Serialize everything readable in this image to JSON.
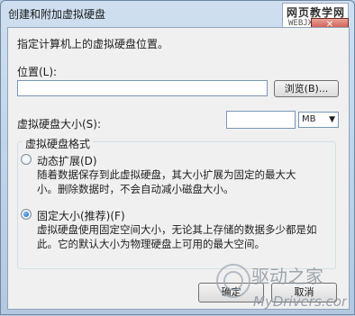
{
  "window": {
    "title": "创建和附加虚拟硬盘",
    "close_glyph": "✕"
  },
  "watermark_top": {
    "line1": "网页教学网",
    "line2": "WEBJX.COM"
  },
  "instruction": "指定计算机上的虚拟硬盘位置。",
  "location": {
    "label": "位置(L):",
    "value": "",
    "browse_label": "浏览(B)..."
  },
  "size": {
    "label": "虚拟硬盘大小(S):",
    "value": "",
    "unit": "MB"
  },
  "format": {
    "group_label": "虚拟硬盘格式",
    "dynamic": {
      "label": "动态扩展(D)",
      "selected": false,
      "desc_line1": "随着数据保存到此虚拟硬盘，其大小扩展为固定的最大大",
      "desc_line2": "小。删除数据时，不会自动减小磁盘大小。"
    },
    "fixed": {
      "label": "固定大小(推荐)(F)",
      "selected": true,
      "desc_line1": "虚拟硬盘使用固定空间大小，无论其上存储的数据多少都是如",
      "desc_line2": "此。它的默认大小为物理硬盘上可用的最大空间。"
    }
  },
  "buttons": {
    "ok": "确定",
    "cancel": "取消"
  },
  "watermark_bottom": {
    "line1": "驱动之家",
    "line2": "MyDrivers.com"
  },
  "colors": {
    "accent": "#1b5fb0",
    "window_frame": "#b3c8df",
    "client_bg": "#f0f0f0"
  }
}
